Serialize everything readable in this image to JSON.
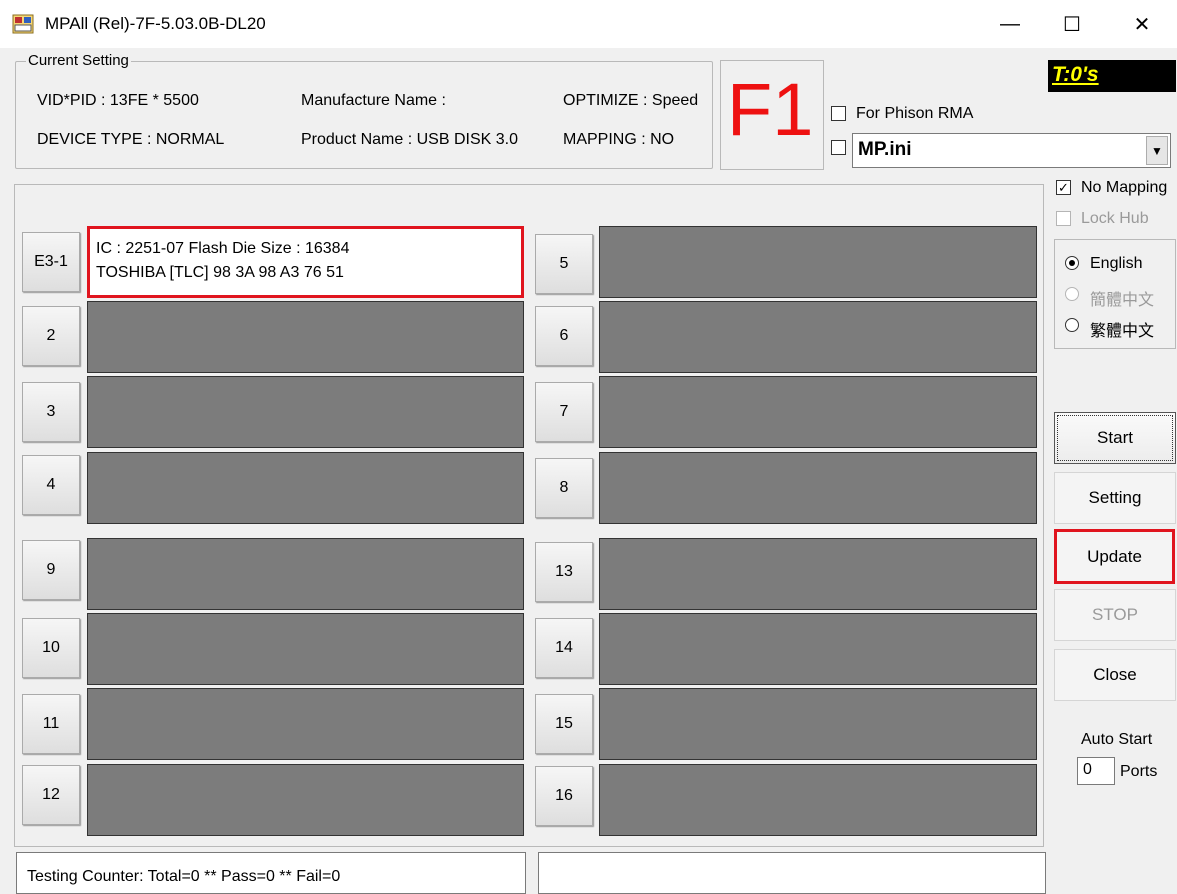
{
  "window": {
    "title": "MPAll (Rel)-7F-5.03.0B-DL20",
    "minimize_glyph": "—",
    "maximize_glyph": "☐",
    "close_glyph": "✕"
  },
  "current_setting": {
    "legend": "Current Setting",
    "vid_pid": "VID*PID : 13FE * 5500",
    "device_type": "DEVICE TYPE : NORMAL",
    "manufacture_name": "Manufacture Name :",
    "product_name": "Product Name : USB DISK 3.0",
    "optimize": "OPTIMIZE : Speed",
    "mapping": "MAPPING : NO"
  },
  "f1_label": "F1",
  "for_phison_rma": {
    "label": "For Phison RMA",
    "checked": false
  },
  "ini": {
    "checked": false,
    "value": "MP.ini",
    "arrow": "▼"
  },
  "timer": "T:0's",
  "options": {
    "no_mapping": {
      "label": "No Mapping",
      "checked": true,
      "check_glyph": "✓"
    },
    "lock_hub": {
      "label": "Lock Hub",
      "checked": false,
      "disabled": true
    }
  },
  "languages": [
    {
      "label": "English",
      "checked": true,
      "disabled": false
    },
    {
      "label": "簡體中文",
      "checked": false,
      "disabled": true
    },
    {
      "label": "繁體中文",
      "checked": false,
      "disabled": false
    }
  ],
  "ports": [
    {
      "label": "E3-1",
      "line1": "IC : 2251-07  Flash Die Size : 16384",
      "line2": "TOSHIBA [TLC] 98 3A 98 A3 76 51",
      "active": true
    },
    {
      "label": "2",
      "line1": "",
      "line2": "",
      "active": false
    },
    {
      "label": "3",
      "line1": "",
      "line2": "",
      "active": false
    },
    {
      "label": "4",
      "line1": "",
      "line2": "",
      "active": false
    },
    {
      "label": "5",
      "line1": "",
      "line2": "",
      "active": false
    },
    {
      "label": "6",
      "line1": "",
      "line2": "",
      "active": false
    },
    {
      "label": "7",
      "line1": "",
      "line2": "",
      "active": false
    },
    {
      "label": "8",
      "line1": "",
      "line2": "",
      "active": false
    },
    {
      "label": "9",
      "line1": "",
      "line2": "",
      "active": false
    },
    {
      "label": "10",
      "line1": "",
      "line2": "",
      "active": false
    },
    {
      "label": "11",
      "line1": "",
      "line2": "",
      "active": false
    },
    {
      "label": "12",
      "line1": "",
      "line2": "",
      "active": false
    },
    {
      "label": "13",
      "line1": "",
      "line2": "",
      "active": false
    },
    {
      "label": "14",
      "line1": "",
      "line2": "",
      "active": false
    },
    {
      "label": "15",
      "line1": "",
      "line2": "",
      "active": false
    },
    {
      "label": "16",
      "line1": "",
      "line2": "",
      "active": false
    }
  ],
  "buttons": {
    "start": "Start",
    "setting": "Setting",
    "update": "Update",
    "stop": "STOP",
    "close": "Close"
  },
  "auto_start": {
    "label": "Auto Start",
    "value": "0",
    "ports_label": "Ports"
  },
  "status": {
    "counter": "Testing Counter: Total=0 ** Pass=0 ** Fail=0",
    "message": ""
  },
  "colors": {
    "highlight_border": "#e0141e",
    "f1_red": "#ee1111",
    "timer_bg": "#000000",
    "timer_text": "#ffff00",
    "slot_gray": "#7c7c7c"
  }
}
